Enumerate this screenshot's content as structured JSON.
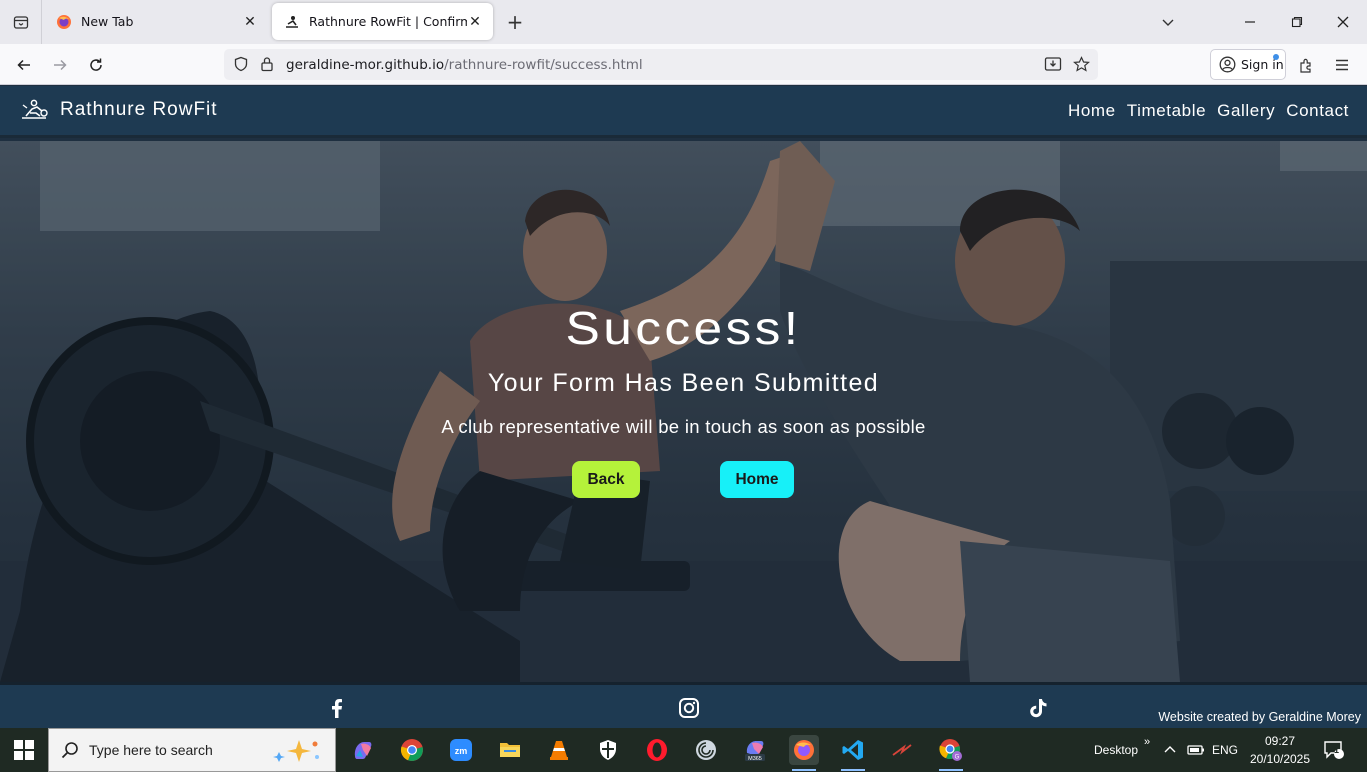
{
  "browser": {
    "tabs": [
      {
        "label": "New Tab",
        "favicon": "firefox-icon",
        "active": false
      },
      {
        "label": "Rathnure RowFit | Confirmation",
        "favicon": "rowing-icon",
        "active": true
      }
    ],
    "url_host": "geraldine-mor.github.io",
    "url_path": "/rathnure-rowfit/success.html",
    "signin_label": "Sign in"
  },
  "site": {
    "brand": "Rathnure RowFit",
    "nav": [
      "Home",
      "Timetable",
      "Gallery",
      "Contact"
    ],
    "hero": {
      "heading": "Success!",
      "subheading": "Your Form Has Been Submitted",
      "message": "A club representative will be in touch as soon as possible",
      "back_label": "Back",
      "home_label": "Home"
    },
    "footer": {
      "socials": [
        "facebook-icon",
        "instagram-icon",
        "tiktok-icon"
      ],
      "credit": "Website created by Geraldine Morey"
    },
    "colors": {
      "header_bg": "#1e3a52",
      "back_button": "#b5f23a",
      "home_button": "#17f0f8"
    }
  },
  "taskbar": {
    "search_placeholder": "Type here to search",
    "apps": [
      "copilot-icon",
      "chrome-icon",
      "zoom-icon",
      "file-explorer-icon",
      "vlc-icon",
      "security-icon",
      "opera-icon",
      "spiral-icon",
      "m365-icon",
      "firefox-icon",
      "vscode-icon",
      "arrow-app-icon",
      "chrome-profile-icon"
    ],
    "desktop_label": "Desktop",
    "language": "ENG",
    "time": "09:27",
    "date": "20/10/2025",
    "notification_count": "1"
  }
}
